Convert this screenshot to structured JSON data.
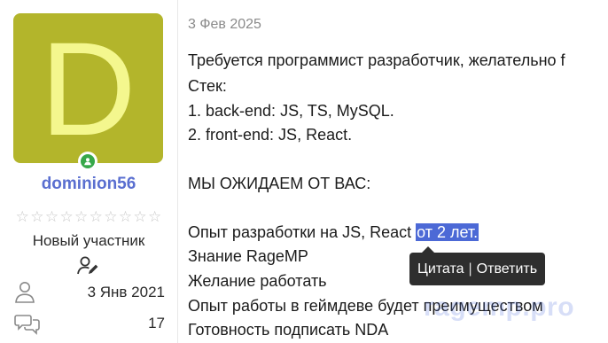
{
  "author": {
    "avatar_letter": "D",
    "avatar_color": "#b3b52b",
    "username": "dominion56",
    "online_status": "online",
    "rating_stars": 10,
    "rating_filled": 0,
    "rank": "Новый участник",
    "joined": "3 Янв 2021",
    "messages": "17"
  },
  "post": {
    "date": "3 Фев 2025",
    "lines": [
      "Требуется программист разработчик, желательно f",
      "Стек:",
      "1. back-end: JS, TS, MySQL.",
      "2. front-end: JS, React.",
      "МЫ ОЖИДАЕМ ОТ ВАС:",
      "Опыт разработки на JS, React ",
      "Знание RageMP",
      "Желание работать",
      "Опыт работы в геймдеве будет преимуществом",
      "Готовность подписать NDA"
    ],
    "highlighted_text": "от 2 лет."
  },
  "tooltip": {
    "quote": "Цитата",
    "separator": "|",
    "reply": "Ответить"
  },
  "watermark": "ragemp.pro",
  "colors": {
    "accent": "#4c69d6",
    "username": "#5a6fd0",
    "online": "#37a84a"
  }
}
